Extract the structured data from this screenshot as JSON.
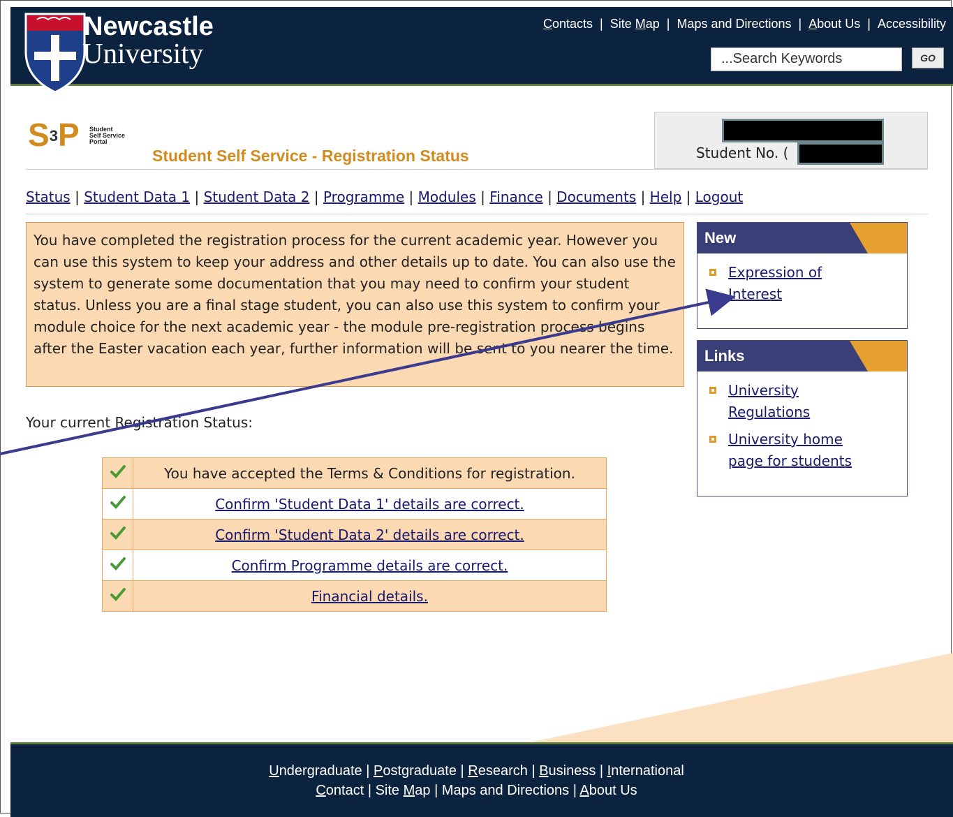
{
  "header": {
    "logo_title": "Newcastle",
    "logo_subtitle": "University",
    "top_links": [
      {
        "first": "C",
        "rest": "ontacts"
      },
      {
        "first": "Site ",
        "under": "M",
        "rest": "ap"
      },
      {
        "first": "",
        "rest": "Maps and Directions"
      },
      {
        "first": "A",
        "rest": "bout Us"
      },
      {
        "first": "",
        "rest": "Accessibility"
      }
    ],
    "search_placeholder": "...Search Keywords",
    "go_label": "GO"
  },
  "portal": {
    "logo_text": "S",
    "logo_sup": "3",
    "logo_p": "P",
    "logo_sub": [
      "Student",
      "Self Service",
      "Portal"
    ],
    "page_title": "Student Self Service - Registration Status",
    "student_no_label": "Student No. ("
  },
  "nav": [
    "Status",
    "Student Data 1",
    "Student Data 2",
    "Programme",
    "Modules",
    "Finance",
    "Documents",
    "Help",
    "Logout"
  ],
  "info_text": "You have completed the registration process for the current academic year. However you can use this system to keep your address and other details up to date. You can also use the system to generate some documentation that you may need to confirm your student status. Unless you are a final stage student, you can also use this system to confirm your module choice for the next academic year - the module pre-registration process begins after the Easter vacation each year, further information will be sent to you nearer the time.",
  "registration_status_label": "Your current Registration Status:",
  "status_rows": [
    {
      "text": "You have accepted the Terms & Conditions for registration.",
      "link": false
    },
    {
      "text": "Confirm 'Student Data 1' details are correct.",
      "link": true
    },
    {
      "text": "Confirm 'Student Data 2' details are correct.",
      "link": true
    },
    {
      "text": "Confirm Programme details are correct.",
      "link": true
    },
    {
      "text": "Financial details.",
      "link": true
    }
  ],
  "sidebar_new": {
    "title": "New",
    "items": [
      "Expression of Interest"
    ]
  },
  "sidebar_links": {
    "title": "Links",
    "items": [
      "University Regulations",
      "University home page for students"
    ]
  },
  "footer": {
    "row1": [
      {
        "u": "U",
        "rest": "ndergraduate"
      },
      {
        "u": "P",
        "rest": "ostgraduate"
      },
      {
        "u": "R",
        "rest": "esearch"
      },
      {
        "u": "B",
        "rest": "usiness"
      },
      {
        "u": "I",
        "rest": "nternational"
      }
    ],
    "row2": [
      {
        "u": "C",
        "rest": "ontact"
      },
      {
        "pre": "Site ",
        "u": "M",
        "rest": "ap"
      },
      {
        "u": "",
        "rest": "Maps and Directions"
      },
      {
        "u": "A",
        "rest": "bout Us"
      }
    ]
  },
  "colors": {
    "header_bg": "#0c2340",
    "accent_orange": "#d18b1f",
    "info_bg": "#fbd9b3",
    "sidebar_head": "#3a3f78",
    "arrow": "#3a3a8e"
  }
}
